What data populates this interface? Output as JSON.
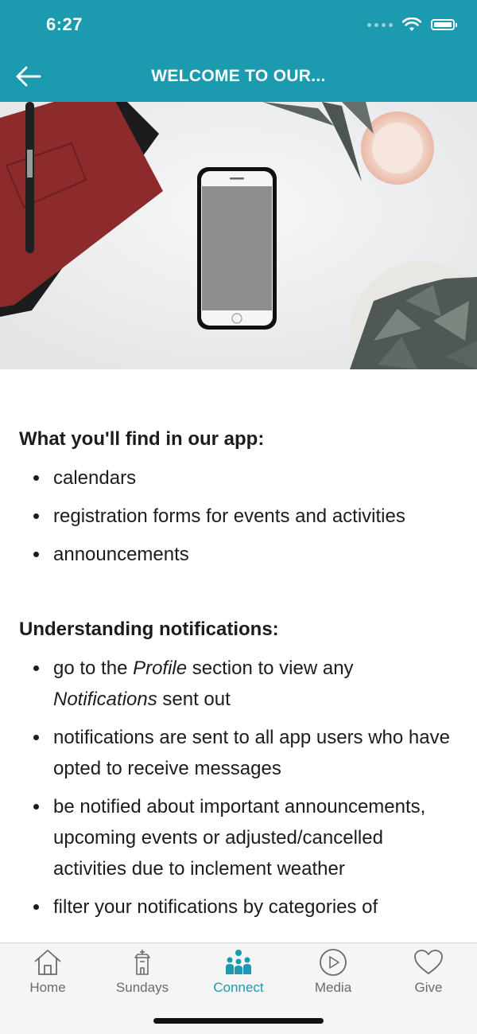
{
  "status": {
    "time": "6:27"
  },
  "header": {
    "title": "WELCOME TO OUR..."
  },
  "sections": [
    {
      "title": "What you'll find in our app:",
      "items": [
        "calendars",
        "registration forms for events and activities",
        "announcements"
      ]
    },
    {
      "title": "Understanding notifications:",
      "items": [
        {
          "parts": [
            "go to the ",
            "Profile",
            " section to view any ",
            "Notifications",
            " sent out"
          ]
        },
        "notifications are sent to all app users who have opted to receive messages",
        "be notified about important announcements, upcoming events or adjusted/cancelled activities due to inclement weather",
        "filter your notifications by categories of"
      ]
    }
  ],
  "tabs": [
    {
      "label": "Home",
      "icon": "home-icon"
    },
    {
      "label": "Sundays",
      "icon": "church-icon"
    },
    {
      "label": "Connect",
      "icon": "people-icon",
      "active": true
    },
    {
      "label": "Media",
      "icon": "play-icon"
    },
    {
      "label": "Give",
      "icon": "heart-icon"
    }
  ],
  "colors": {
    "brand": "#1c9ab0",
    "active_tab": "#1c9ab0",
    "inactive_tab": "#6b6b6b"
  }
}
